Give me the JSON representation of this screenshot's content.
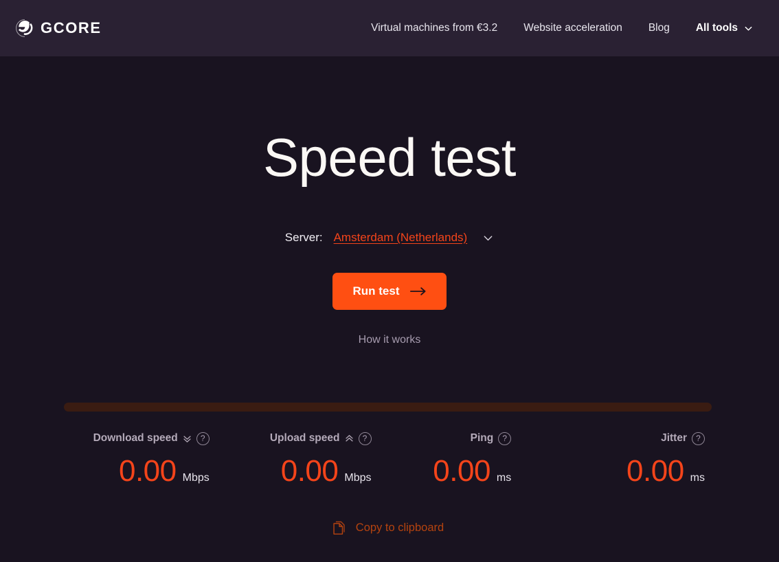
{
  "header": {
    "brand": {
      "name": "GCORE",
      "logo_icon": "gcore-swirl-logo-icon"
    },
    "nav": [
      {
        "label": "Virtual machines from €3.2",
        "strong": false
      },
      {
        "label": "Website acceleration",
        "strong": false
      },
      {
        "label": "Blog",
        "strong": false
      },
      {
        "label": "All tools",
        "strong": true,
        "icon": "chevron-down-icon"
      }
    ]
  },
  "hero": {
    "title": "Speed test",
    "server_label": "Server:",
    "server_value": "Amsterdam (Netherlands)",
    "server_chevron_icon": "chevron-down-icon",
    "run_button": "Run test",
    "run_button_icon": "arrow-right-icon",
    "how_it_works": "How it works"
  },
  "results": {
    "progress_percent": 0,
    "metrics": [
      {
        "name": "Download speed",
        "trend_icon": "double-chevron-down-icon",
        "help_icon": "question-mark-icon",
        "help_glyph": "?",
        "value": "0.00",
        "unit": "Mbps"
      },
      {
        "name": "Upload speed",
        "trend_icon": "double-chevron-up-icon",
        "help_icon": "question-mark-icon",
        "help_glyph": "?",
        "value": "0.00",
        "unit": "Mbps"
      },
      {
        "name": "Ping",
        "trend_icon": null,
        "help_icon": "question-mark-icon",
        "help_glyph": "?",
        "value": "0.00",
        "unit": "ms"
      },
      {
        "name": "Jitter",
        "trend_icon": null,
        "help_icon": "question-mark-icon",
        "help_glyph": "?",
        "value": "0.00",
        "unit": "ms"
      }
    ],
    "copy_label": "Copy to clipboard",
    "copy_icon": "copy-document-icon"
  },
  "colors": {
    "header_bg": "#2a2133",
    "page_bg": "#191320",
    "accent_orange": "#ff4f12",
    "value_orange": "#f4441a",
    "track_maroon": "#3a1c12",
    "muted_text": "#a79caf"
  }
}
